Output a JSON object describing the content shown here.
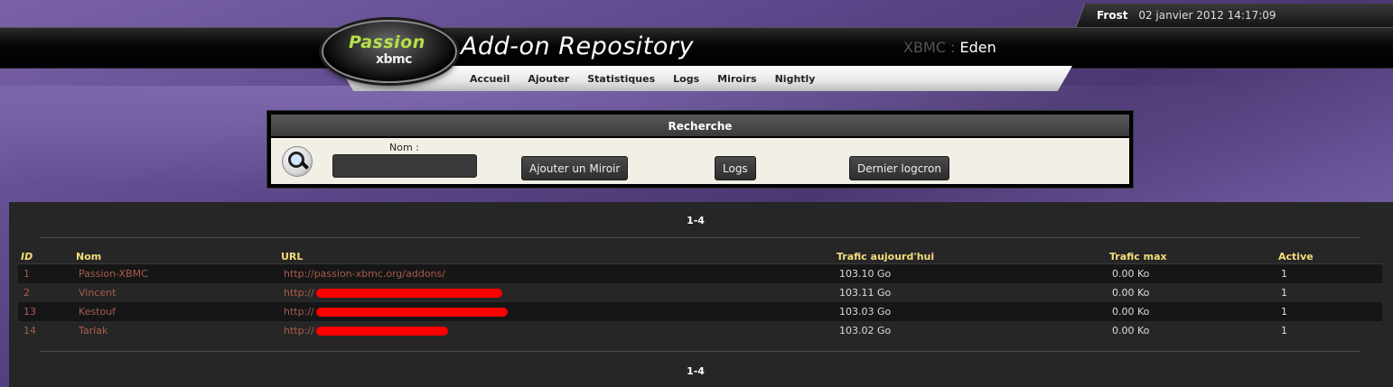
{
  "user": {
    "name": "Frost",
    "datetime": "02 janvier 2012 14:17:09"
  },
  "logo": {
    "line1": "Passion",
    "line2": "xbmc"
  },
  "header": {
    "title": "Add-on Repository",
    "version_prefix": "XBMC :",
    "version_name": "Eden"
  },
  "nav": [
    "Accueil",
    "Ajouter",
    "Statistiques",
    "Logs",
    "Miroirs",
    "Nightly"
  ],
  "search": {
    "title": "Recherche",
    "name_label": "Nom :",
    "name_value": "",
    "buttons": {
      "add_mirror": "Ajouter un Miroir",
      "logs": "Logs",
      "last_logcron": "Dernier logcron"
    }
  },
  "results": {
    "pager": "1-4",
    "columns": [
      "ID",
      "Nom",
      "URL",
      "Trafic aujourd'hui",
      "Trafic max",
      "Active"
    ],
    "rows": [
      {
        "id": "1",
        "name": "Passion-XBMC",
        "url": "http://passion-xbmc.org/addons/",
        "traffic": "103.10 Go",
        "max": "0.00 Ko",
        "active": "1",
        "redacted": false
      },
      {
        "id": "2",
        "name": "Vincent",
        "url": "http://",
        "traffic": "103.11 Go",
        "max": "0.00 Ko",
        "active": "1",
        "redacted": true
      },
      {
        "id": "13",
        "name": "Kestouf",
        "url": "http://",
        "traffic": "103.03 Go",
        "max": "0.00 Ko",
        "active": "1",
        "redacted": true
      },
      {
        "id": "14",
        "name": "Tarlak",
        "url": "http://",
        "traffic": "103.02 Go",
        "max": "0.00 Ko",
        "active": "1",
        "redacted": true
      }
    ]
  },
  "colors": {
    "accent_header_text": "#f4dd7c",
    "link_text": "#a85c4a",
    "redaction": "#ff0000",
    "logo_green": "#b4e04a"
  }
}
